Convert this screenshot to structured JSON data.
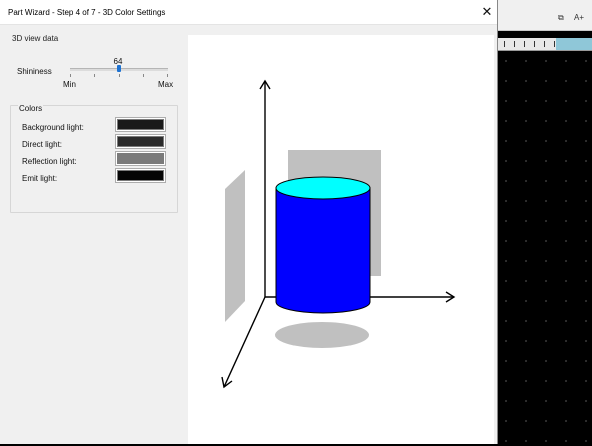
{
  "window": {
    "title": "Part Wizard - Step 4 of 7 - 3D Color Settings",
    "close_glyph": "✕"
  },
  "section": {
    "title": "3D view data"
  },
  "shininess": {
    "label": "Shininess",
    "value": "64",
    "min_label": "Min",
    "max_label": "Max",
    "level": 0.5
  },
  "colors": {
    "group_title": "Colors",
    "items": [
      {
        "label": "Background light:",
        "color": "#1a1a1a"
      },
      {
        "label": "Direct light:",
        "color": "#2b2b2b"
      },
      {
        "label": "Reflection light:",
        "color": "#7a7a7a"
      },
      {
        "label": "Emit light:",
        "color": "#050505"
      }
    ]
  },
  "preview": {
    "cylinder_body_color": "#0000ff",
    "cylinder_top_color": "#00ffff",
    "shadow_color": "#c0c0c0",
    "axis_color": "#000000"
  },
  "background_app": {
    "toolbar_items": [
      "A+"
    ],
    "canvas_color": "#000000"
  }
}
